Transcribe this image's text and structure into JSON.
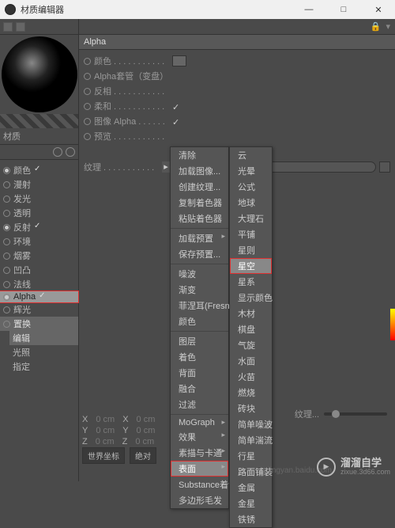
{
  "window": {
    "title": "材质编辑器",
    "min": "—",
    "max": "□",
    "close": "✕"
  },
  "leftcol": {
    "material_label": "材质",
    "channels": [
      {
        "name": "颜色",
        "on": true,
        "checked": true
      },
      {
        "name": "漫射",
        "on": false,
        "checked": false
      },
      {
        "name": "发光",
        "on": false,
        "checked": false
      },
      {
        "name": "透明",
        "on": false,
        "checked": false
      },
      {
        "name": "反射",
        "on": true,
        "checked": true
      },
      {
        "name": "环境",
        "on": false,
        "checked": false
      },
      {
        "name": "烟雾",
        "on": false,
        "checked": false
      },
      {
        "name": "凹凸",
        "on": false,
        "checked": false
      },
      {
        "name": "法线",
        "on": false,
        "checked": false
      },
      {
        "name": "Alpha",
        "on": true,
        "checked": true,
        "hl": true
      },
      {
        "name": "辉光",
        "on": false,
        "checked": false
      },
      {
        "name": "置换",
        "on": false,
        "checked": false,
        "hl2": true
      }
    ],
    "subs": [
      {
        "name": "编辑",
        "hl": true
      },
      {
        "name": "光照",
        "hl": false
      },
      {
        "name": "指定",
        "hl": false
      }
    ]
  },
  "header": "Alpha",
  "props": [
    {
      "label": "颜色 . . . . . . . . . . .",
      "has_swatch": true
    },
    {
      "label": "Alpha套管（变盘）"
    },
    {
      "label": "反相 . . . . . . . . . . ."
    },
    {
      "label": "柔和 . . . . . . . . . . .",
      "checked": true
    },
    {
      "label": "图像 Alpha . . . . . .",
      "checked": true
    },
    {
      "label": "预览 . . . . . . . . . . ."
    }
  ],
  "texture_label": "纹理 . . . . . . . . . . .",
  "menu1": [
    {
      "label": "清除"
    },
    {
      "label": "加载图像..."
    },
    {
      "label": "创建纹理..."
    },
    {
      "label": "复制着色器"
    },
    {
      "label": "粘贴着色器"
    },
    {
      "sep": true
    },
    {
      "label": "加载预置",
      "arrow": true
    },
    {
      "label": "保存预置..."
    },
    {
      "sep": true
    },
    {
      "label": "噪波"
    },
    {
      "label": "渐变"
    },
    {
      "label": "菲涅耳(Fresnel)"
    },
    {
      "label": "颜色"
    },
    {
      "sep": true
    },
    {
      "label": "图层"
    },
    {
      "label": "着色"
    },
    {
      "label": "背面"
    },
    {
      "label": "融合"
    },
    {
      "label": "过滤"
    },
    {
      "sep": true
    },
    {
      "label": "MoGraph",
      "arrow": true
    },
    {
      "label": "效果",
      "arrow": true
    },
    {
      "label": "素描与卡通",
      "arrow": true
    },
    {
      "label": "表面",
      "arrow": true,
      "sel": true,
      "red": true
    },
    {
      "label": "Substance着色器"
    },
    {
      "label": "多边形毛发"
    }
  ],
  "menu2": [
    {
      "label": "云"
    },
    {
      "label": "光晕"
    },
    {
      "label": "公式"
    },
    {
      "label": "地球"
    },
    {
      "label": "大理石"
    },
    {
      "label": "平铺"
    },
    {
      "label": "星则"
    },
    {
      "label": "星空",
      "sel": true,
      "red": true
    },
    {
      "label": "星系"
    },
    {
      "label": "显示颜色"
    },
    {
      "label": "木材"
    },
    {
      "label": "棋盘"
    },
    {
      "label": "气旋"
    },
    {
      "label": "水面"
    },
    {
      "label": "火苗"
    },
    {
      "label": "燃烧"
    },
    {
      "label": "砖块"
    },
    {
      "label": "简单噪波"
    },
    {
      "label": "简单湍流"
    },
    {
      "label": "行星"
    },
    {
      "label": "路面铺装"
    },
    {
      "label": "金属"
    },
    {
      "label": "金星"
    },
    {
      "label": "铁锈"
    }
  ],
  "coords": {
    "rows": [
      {
        "a": "X",
        "av": "0 cm",
        "b": "X",
        "bv": "0 cm"
      },
      {
        "a": "Y",
        "av": "0 cm",
        "b": "Y",
        "bv": "0 cm"
      },
      {
        "a": "Z",
        "av": "0 cm",
        "b": "Z",
        "bv": "0 cm"
      }
    ]
  },
  "dropdowns": {
    "d1": "世界坐标",
    "d2": "绝对"
  },
  "slider_label": "纹理...",
  "watermark": {
    "name": "溜溜自学",
    "url": "zixue.3d66.com"
  },
  "footer_url": "jingyan.baidu.com"
}
